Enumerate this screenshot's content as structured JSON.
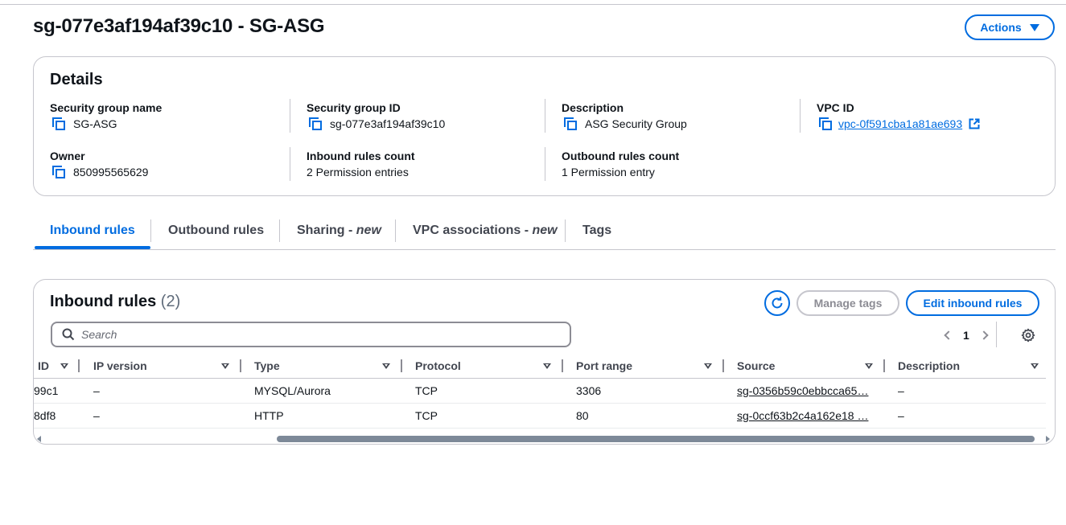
{
  "header": {
    "title": "sg-077e3af194af39c10 - SG-ASG",
    "actions_label": "Actions"
  },
  "details": {
    "heading": "Details",
    "security_group_name": {
      "label": "Security group name",
      "value": "SG-ASG"
    },
    "security_group_id": {
      "label": "Security group ID",
      "value": "sg-077e3af194af39c10"
    },
    "description": {
      "label": "Description",
      "value": "ASG Security Group"
    },
    "vpc_id": {
      "label": "VPC ID",
      "value": "vpc-0f591cba1a81ae693"
    },
    "owner": {
      "label": "Owner",
      "value": "850995565629"
    },
    "inbound_rules_count": {
      "label": "Inbound rules count",
      "value": "2 Permission entries"
    },
    "outbound_rules_count": {
      "label": "Outbound rules count",
      "value": "1 Permission entry"
    }
  },
  "tabs": [
    {
      "label": "Inbound rules",
      "suffix": ""
    },
    {
      "label": "Outbound rules",
      "suffix": ""
    },
    {
      "label": "Sharing - ",
      "suffix": "new"
    },
    {
      "label": "VPC associations - ",
      "suffix": "new"
    },
    {
      "label": "Tags",
      "suffix": ""
    }
  ],
  "inbound": {
    "heading": "Inbound rules",
    "count": "(2)",
    "manage_tags_label": "Manage tags",
    "edit_label": "Edit inbound rules",
    "search_placeholder": "Search",
    "page": "1",
    "columns": [
      "ID",
      "IP version",
      "Type",
      "Protocol",
      "Port range",
      "Source",
      "Description"
    ],
    "rows": [
      {
        "id": "99c1",
        "ip_version": "–",
        "type": "MYSQL/Aurora",
        "protocol": "TCP",
        "port_range": "3306",
        "source": "sg-0356b59c0ebbcca65…",
        "description": "–"
      },
      {
        "id": "8df8",
        "ip_version": "–",
        "type": "HTTP",
        "protocol": "TCP",
        "port_range": "80",
        "source": "sg-0ccf63b2c4a162e18 …",
        "description": "–"
      }
    ]
  },
  "colors": {
    "accent": "#006ce0",
    "border": "#c6c6cd",
    "text": "#0f141a",
    "muted": "#424650"
  }
}
